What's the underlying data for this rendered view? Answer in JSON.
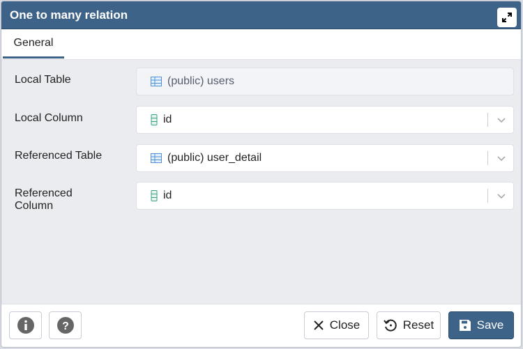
{
  "dialog": {
    "title": "One to many relation",
    "maximize_icon": "expand-icon"
  },
  "tabs": [
    {
      "label": "General",
      "active": true
    }
  ],
  "fields": [
    {
      "label": "Local Table",
      "value": "(public) users",
      "icon": "table-icon",
      "readonly": true
    },
    {
      "label": "Local Column",
      "value": "id",
      "icon": "column-icon",
      "readonly": false
    },
    {
      "label": "Referenced Table",
      "value": "(public) user_detail",
      "icon": "table-icon",
      "readonly": false
    },
    {
      "label": "Referenced Column",
      "value": "id",
      "icon": "column-icon",
      "readonly": false
    }
  ],
  "footer": {
    "info_icon": "info-icon",
    "help_icon": "help-icon",
    "close_label": "Close",
    "reset_label": "Reset",
    "save_label": "Save"
  },
  "colors": {
    "accent": "#3d6389",
    "table_icon": "#4a90d9",
    "column_icon": "#3aa17e"
  }
}
